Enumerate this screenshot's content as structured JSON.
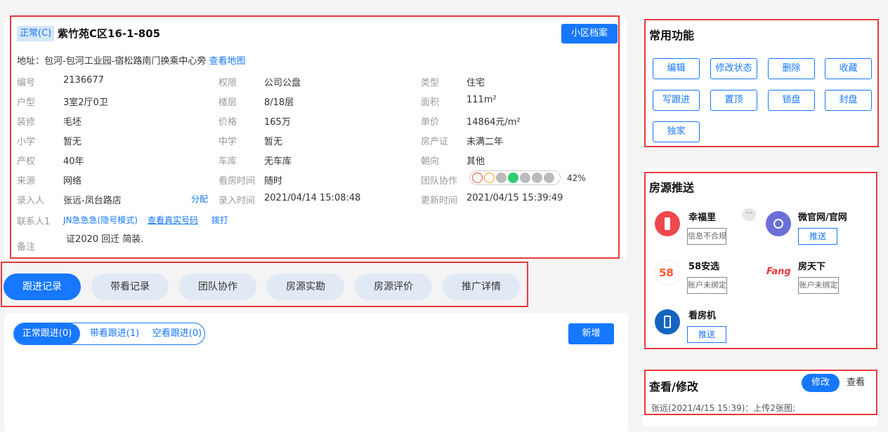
{
  "property": {
    "status": "正常(C)",
    "title": "紫竹苑C区16-1-805",
    "archive_button": "小区档案",
    "address_label": "地址：",
    "address": "包河-包河工业园-宿松路南门换乘中心旁",
    "map_link": "查看地图",
    "fields": {
      "code": {
        "label": "编号",
        "value": "2136677"
      },
      "permission": {
        "label": "权限",
        "value": "公司公盘"
      },
      "type": {
        "label": "类型",
        "value": "住宅"
      },
      "layout": {
        "label": "户型",
        "value": "3室2厅0卫"
      },
      "floor": {
        "label": "楼层",
        "value": "8/18层"
      },
      "area": {
        "label": "面积",
        "value": "111m²"
      },
      "decoration": {
        "label": "装修",
        "value": "毛坯"
      },
      "price": {
        "label": "价格",
        "value": "165万"
      },
      "unit_price": {
        "label": "单价",
        "value": "14864元/m²"
      },
      "primary_school": {
        "label": "小学",
        "value": "暂无"
      },
      "middle_school": {
        "label": "中学",
        "value": "暂无"
      },
      "certificate": {
        "label": "房产证",
        "value": "未满二年"
      },
      "ownership": {
        "label": "产权",
        "value": "40年"
      },
      "garage": {
        "label": "车库",
        "value": "无车库"
      },
      "orientation": {
        "label": "朝向",
        "value": "其他"
      },
      "source": {
        "label": "来源",
        "value": "网络"
      },
      "viewing_time": {
        "label": "看房时间",
        "value": "随时"
      },
      "team": {
        "label": "团队协作",
        "value": "42%"
      },
      "entered_by": {
        "label": "录入人",
        "value": "张远-凤台路店",
        "action": "分配"
      },
      "entered_time": {
        "label": "录入时间",
        "value": "2021/04/14 15:08:48"
      },
      "updated_time": {
        "label": "更新时间",
        "value": "2021/04/15 15:39:49"
      },
      "contact": {
        "label": "联系人1",
        "value": "JN急急急(隐号模式)",
        "real_number": "查看真实号码",
        "dial": "拨打"
      },
      "remark": {
        "label": "备注",
        "value": "证2020 回迁  简装."
      }
    }
  },
  "tabs": [
    {
      "label": "跟进记录",
      "active": true
    },
    {
      "label": "带看记录",
      "active": false
    },
    {
      "label": "团队协作",
      "active": false
    },
    {
      "label": "房源实勘",
      "active": false
    },
    {
      "label": "房源评价",
      "active": false
    },
    {
      "label": "推广详情",
      "active": false
    }
  ],
  "followup": {
    "subtabs": [
      {
        "label": "正常跟进(0)",
        "active": true
      },
      {
        "label": "带看跟进(1)",
        "active": false
      },
      {
        "label": "空看跟进(0)",
        "active": false
      }
    ],
    "add_button": "新增"
  },
  "common": {
    "title": "常用功能",
    "buttons": [
      "编辑",
      "修改状态",
      "删除",
      "收藏",
      "写跟进",
      "置顶",
      "锁盘",
      "封盘",
      "独家"
    ]
  },
  "push": {
    "title": "房源推送",
    "more": "···",
    "items": [
      {
        "name": "幸福里",
        "note": "信息不合规",
        "color": "#f0474e",
        "icon": "xingfuli-icon"
      },
      {
        "name": "微官网/官网",
        "button": "推送",
        "color": "#6b6fd8",
        "icon": "link-icon"
      },
      {
        "name": "58安选",
        "note": "账户未绑定",
        "color": "#ffffff",
        "icon": "58-icon"
      },
      {
        "name": "房天下",
        "note": "账户未绑定",
        "color": "#ffffff",
        "icon": "fang-icon"
      },
      {
        "name": "看房机",
        "button": "推送",
        "color": "#1565c0",
        "icon": "kiosk-icon"
      }
    ]
  },
  "review": {
    "title": "查看/修改",
    "modify": "修改",
    "view": "查看",
    "log": "张远(2021/4/15 15:39)：上传2张图;"
  },
  "colors": {
    "accent": "#1677ff",
    "highlight": "#e4393c",
    "tab_bg": "#e1e9f5"
  }
}
